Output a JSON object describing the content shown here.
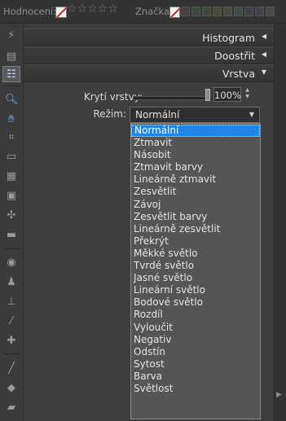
{
  "filter_bar": {
    "rating_label": "Hodnocení:",
    "stars": "☆☆☆☆☆",
    "tag_label": "Značka:",
    "tag_colors": [
      "#4a3f3f",
      "#3f4a3f",
      "#3f4a3f",
      "#4a4a3a",
      "#4a4a3f",
      "#3f4a4a",
      "#3f3f4a",
      "#473f4a",
      "#4a4a4a"
    ]
  },
  "toolbar": {
    "tools": [
      "lightning-icon",
      "print-stamp-icon",
      "adjust-panel-icon",
      "zoom-icon",
      "hand-icon",
      "crop-icon",
      "straighten-icon",
      "perspective-icon",
      "frame-icon",
      "noise-icon",
      "gradient-icon",
      "eye-icon",
      "clone-stamp-icon",
      "stamp-icon",
      "magic-wand-icon",
      "heal-icon",
      "brush-icon",
      "fill-icon",
      "eraser-icon"
    ]
  },
  "panel": {
    "sections": [
      {
        "title": "Histogram",
        "arrow": "◀"
      },
      {
        "title": "Doostřit",
        "arrow": "◀"
      },
      {
        "title": "Vrstva",
        "arrow": "▼"
      }
    ],
    "opacity_label": "Krytí vrstvy:",
    "opacity_value": "100%",
    "opacity_fraction": 1.0,
    "mode_label": "Režim:",
    "mode_selected": "Normální",
    "mode_options": [
      "Normální",
      "Ztmavit",
      "Násobit",
      "Ztmavit barvy",
      "Lineárně ztmavit",
      "Zesvětlit",
      "Závoj",
      "Zesvětlit barvy",
      "Lineárně zesvětlit",
      "Překrýt",
      "Měkké světlo",
      "Tvrdé světlo",
      "Jasné světlo",
      "Lineární světlo",
      "Bodové světlo",
      "Rozdíl",
      "Vyloučit",
      "Negativ",
      "Odstín",
      "Sytost",
      "Barva",
      "Světlost"
    ]
  }
}
